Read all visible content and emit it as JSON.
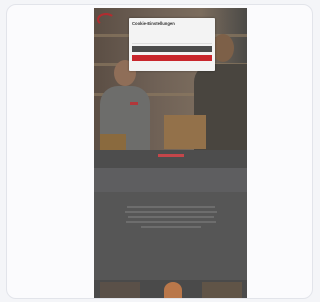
{
  "cookie_dialog": {
    "title": "Cookie-Einstellungen",
    "description": "",
    "secondary_button_label": "",
    "primary_button_label": ""
  },
  "content": {
    "section_title": "",
    "section_subtitle": ""
  },
  "colors": {
    "brand_red": "#c8262c",
    "dark_gray": "#4b4b4b"
  },
  "icons": {
    "brand": "logo-arc-icon"
  }
}
